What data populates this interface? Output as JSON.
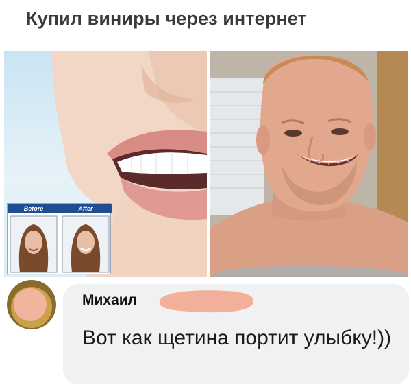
{
  "post": {
    "title": "Купил виниры через интернет"
  },
  "ad_image": {
    "before_label": "Before",
    "after_label": "After"
  },
  "comment": {
    "author": "Михаил",
    "text": "Вот как щетина портит улыбку!))"
  },
  "colors": {
    "title_text": "#3b3b3b",
    "bubble_bg": "#f0f1f3",
    "redaction": "#f2b09a",
    "ad_label_bg": "#1f4d94"
  }
}
